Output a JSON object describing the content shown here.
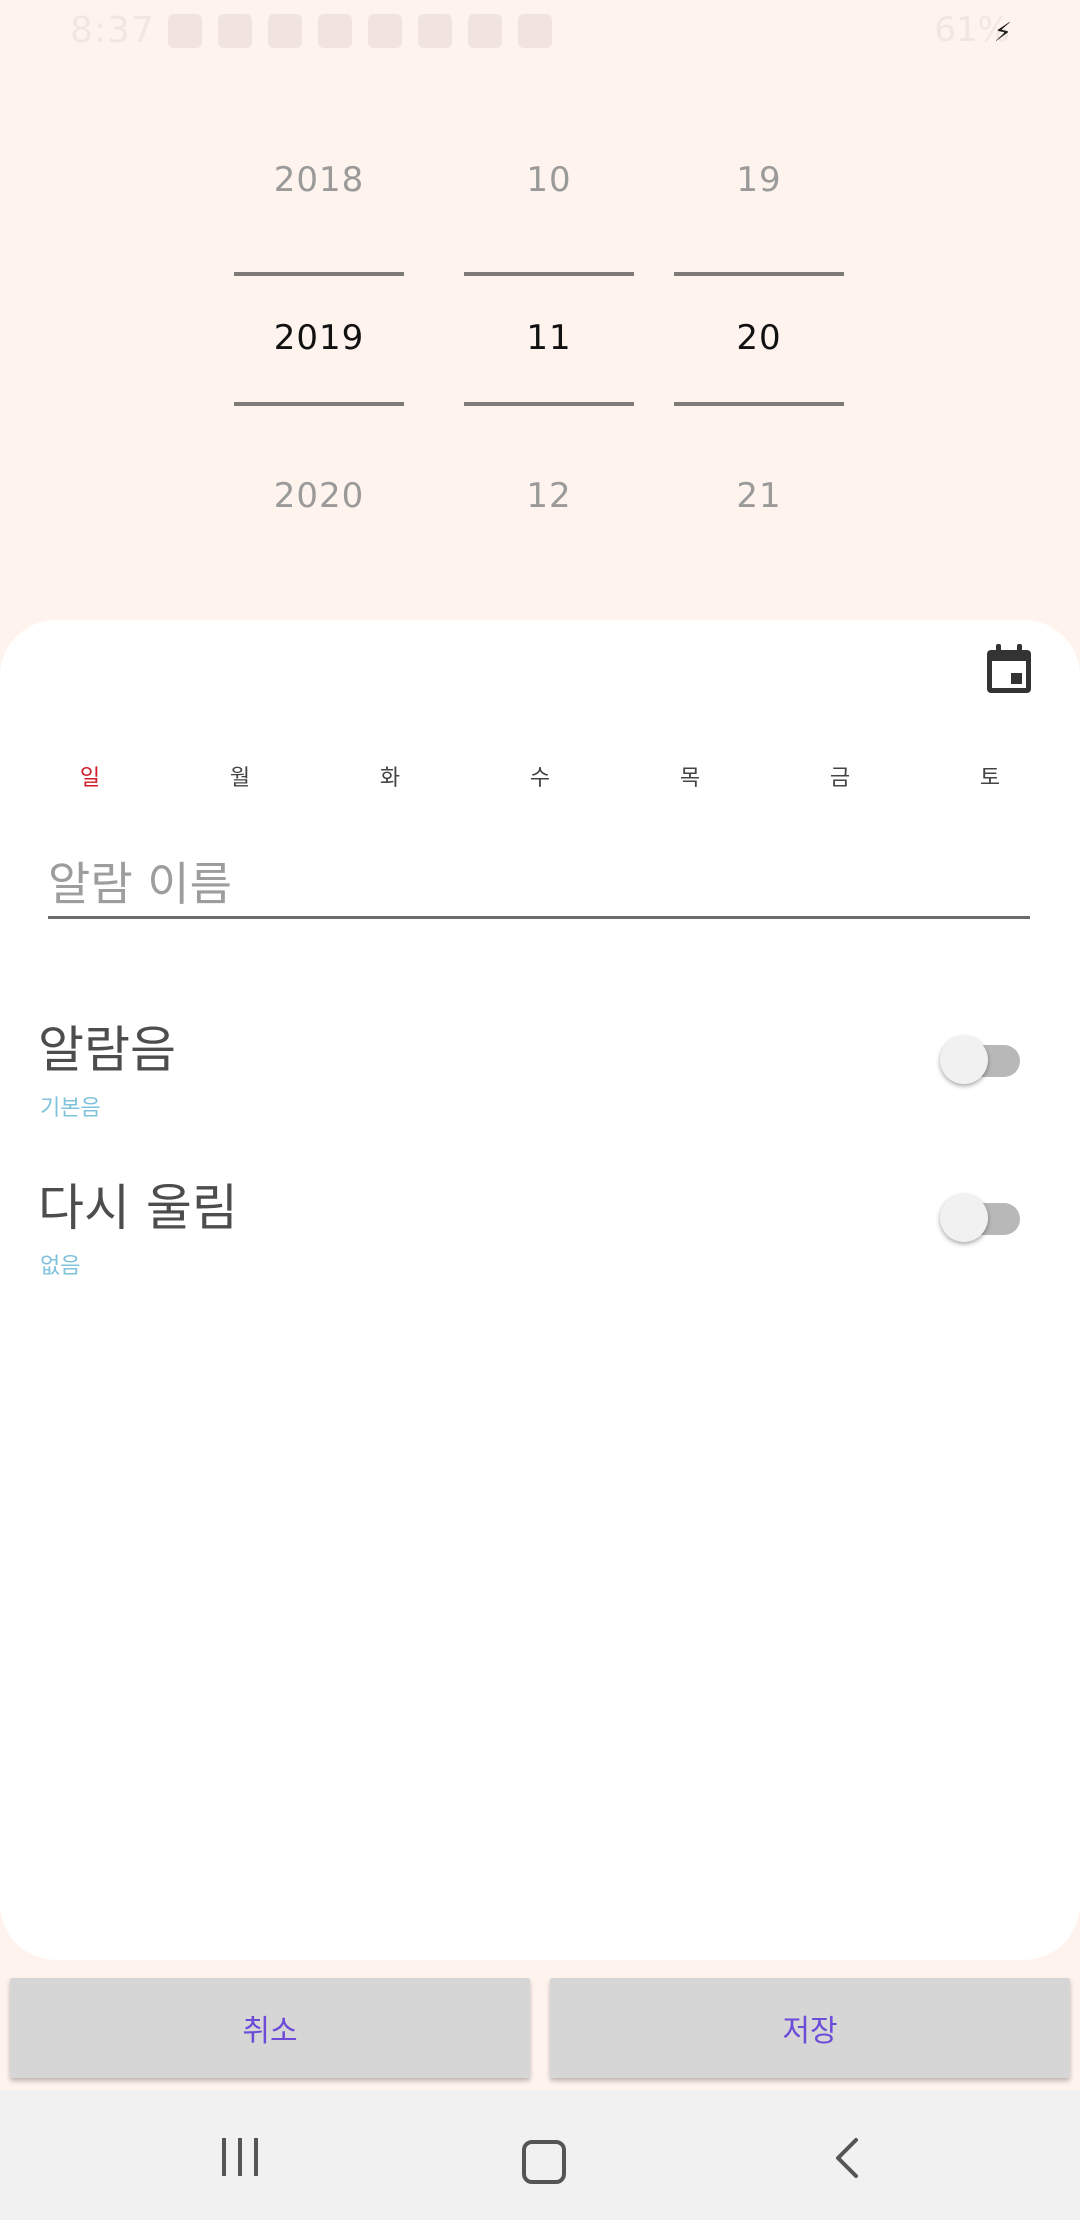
{
  "status_bar": {
    "time": "8:37",
    "battery": "61%"
  },
  "picker": {
    "year": {
      "prev": "2018",
      "current": "2019",
      "next": "2020"
    },
    "month": {
      "prev": "10",
      "current": "11",
      "next": "12"
    },
    "day": {
      "prev": "19",
      "current": "20",
      "next": "21"
    }
  },
  "weekdays": [
    "일",
    "월",
    "화",
    "수",
    "목",
    "금",
    "토"
  ],
  "alarm_name": {
    "placeholder": "알람 이름",
    "value": ""
  },
  "sound": {
    "title": "알람음",
    "subtitle": "기본음",
    "enabled": false
  },
  "snooze": {
    "title": "다시 울림",
    "subtitle": "없음",
    "enabled": false
  },
  "buttons": {
    "cancel": "취소",
    "save": "저장"
  },
  "colors": {
    "background": "#fff3ee",
    "sunday": "#d11b2a",
    "subtitle": "#7ec3db",
    "button_text": "#6b4bd8"
  }
}
